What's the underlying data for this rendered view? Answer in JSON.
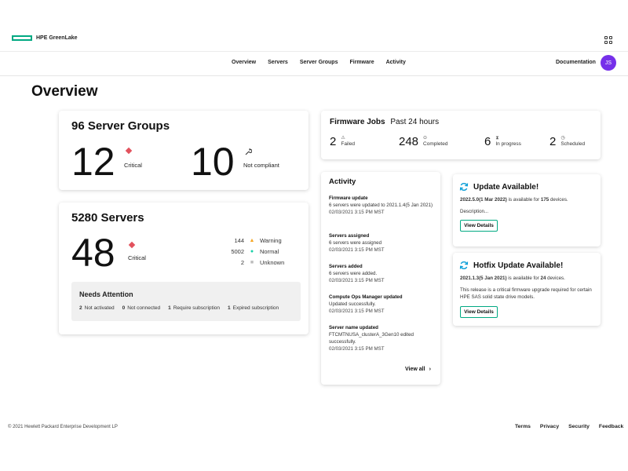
{
  "header": {
    "brand": "HPE GreenLake",
    "icons": [
      "apps-grid-icon"
    ],
    "accent_color": "#01a982"
  },
  "nav": {
    "items": [
      "Overview",
      "Servers",
      "Server Groups",
      "Firmware",
      "Activity"
    ],
    "documentation": "Documentation",
    "avatar_initials": "JS",
    "avatar_color": "#7630ea"
  },
  "page_title": "Overview",
  "server_groups": {
    "title": "96 Server Groups",
    "critical_count": "12",
    "critical_label": "Critical",
    "noncompliant_count": "10",
    "noncompliant_label": "Not compliant"
  },
  "servers": {
    "title": "5280 Servers",
    "critical_count": "48",
    "critical_label": "Critical",
    "statuses": [
      {
        "count": "144",
        "label": "Warning",
        "icon": "warning-triangle-icon",
        "color": "#f5a623"
      },
      {
        "count": "5002",
        "label": "Normal",
        "icon": "normal-dot-icon",
        "color": "#17d0a6"
      },
      {
        "count": "2",
        "label": "Unknown",
        "icon": "unknown-square-icon",
        "color": "#bbbbbb"
      }
    ],
    "attention": {
      "title": "Needs Attention",
      "items": [
        {
          "count": "2",
          "label": "Not activated"
        },
        {
          "count": "0",
          "label": "Not connected"
        },
        {
          "count": "1",
          "label": "Require subscription"
        },
        {
          "count": "1",
          "label": "Expired subscription"
        }
      ]
    }
  },
  "firmware_jobs": {
    "title": "Firmware Jobs",
    "period": "Past 24 hours",
    "jobs": [
      {
        "count": "2",
        "label": "Failed",
        "icon": "alert-icon"
      },
      {
        "count": "248",
        "label": "Completed",
        "icon": "check-circle-icon"
      },
      {
        "count": "6",
        "label": "In progress",
        "icon": "hourglass-icon"
      },
      {
        "count": "2",
        "label": "Scheduled",
        "icon": "clock-icon"
      }
    ]
  },
  "activity": {
    "title": "Activity",
    "items": [
      {
        "title": "Firmware update",
        "desc": "6 servers were updated to 2021.1.4(5 Jan 2021)",
        "time": "02/03/2021 3:15 PM MST"
      },
      {
        "title": "Servers assigned",
        "desc": "6 servers were assigned",
        "time": "02/03/2021 3:15 PM MST"
      },
      {
        "title": "Servers added",
        "desc": "6 servers were added.",
        "time": "02/03/2021 3:15 PM MST"
      },
      {
        "title": "Compute Ops Manager updated",
        "desc": "Updated successfully.",
        "time": "02/03/2021 3:15 PM MST"
      },
      {
        "title": "Server name updated",
        "desc": "FTCMTNUSA_clusterA_3Gen10 edited successfully.",
        "time": "02/03/2021 3:15 PM MST"
      }
    ],
    "view_all": "View all"
  },
  "update_card": {
    "title": "Update Available!",
    "version": "2022.5.0(1 Mar 2022)",
    "available_text": "is available for",
    "device_count": "175",
    "devices_suffix": "devices.",
    "description": "Description...",
    "button": "View Details"
  },
  "hotfix_card": {
    "title": "Hotfix Update Available!",
    "version": "2021.1.3(5 Jan 2021)",
    "available_text": "is available for",
    "device_count": "24",
    "devices_suffix": "devices.",
    "description": "This release is a critical firmware upgrade required for certain HPE SAS solid state drive models.",
    "button": "View Details"
  },
  "footer": {
    "copyright": "© 2021 Hewlett Packard Enterprise Development LP",
    "links": [
      "Terms",
      "Privacy",
      "Security",
      "Feedback"
    ]
  }
}
